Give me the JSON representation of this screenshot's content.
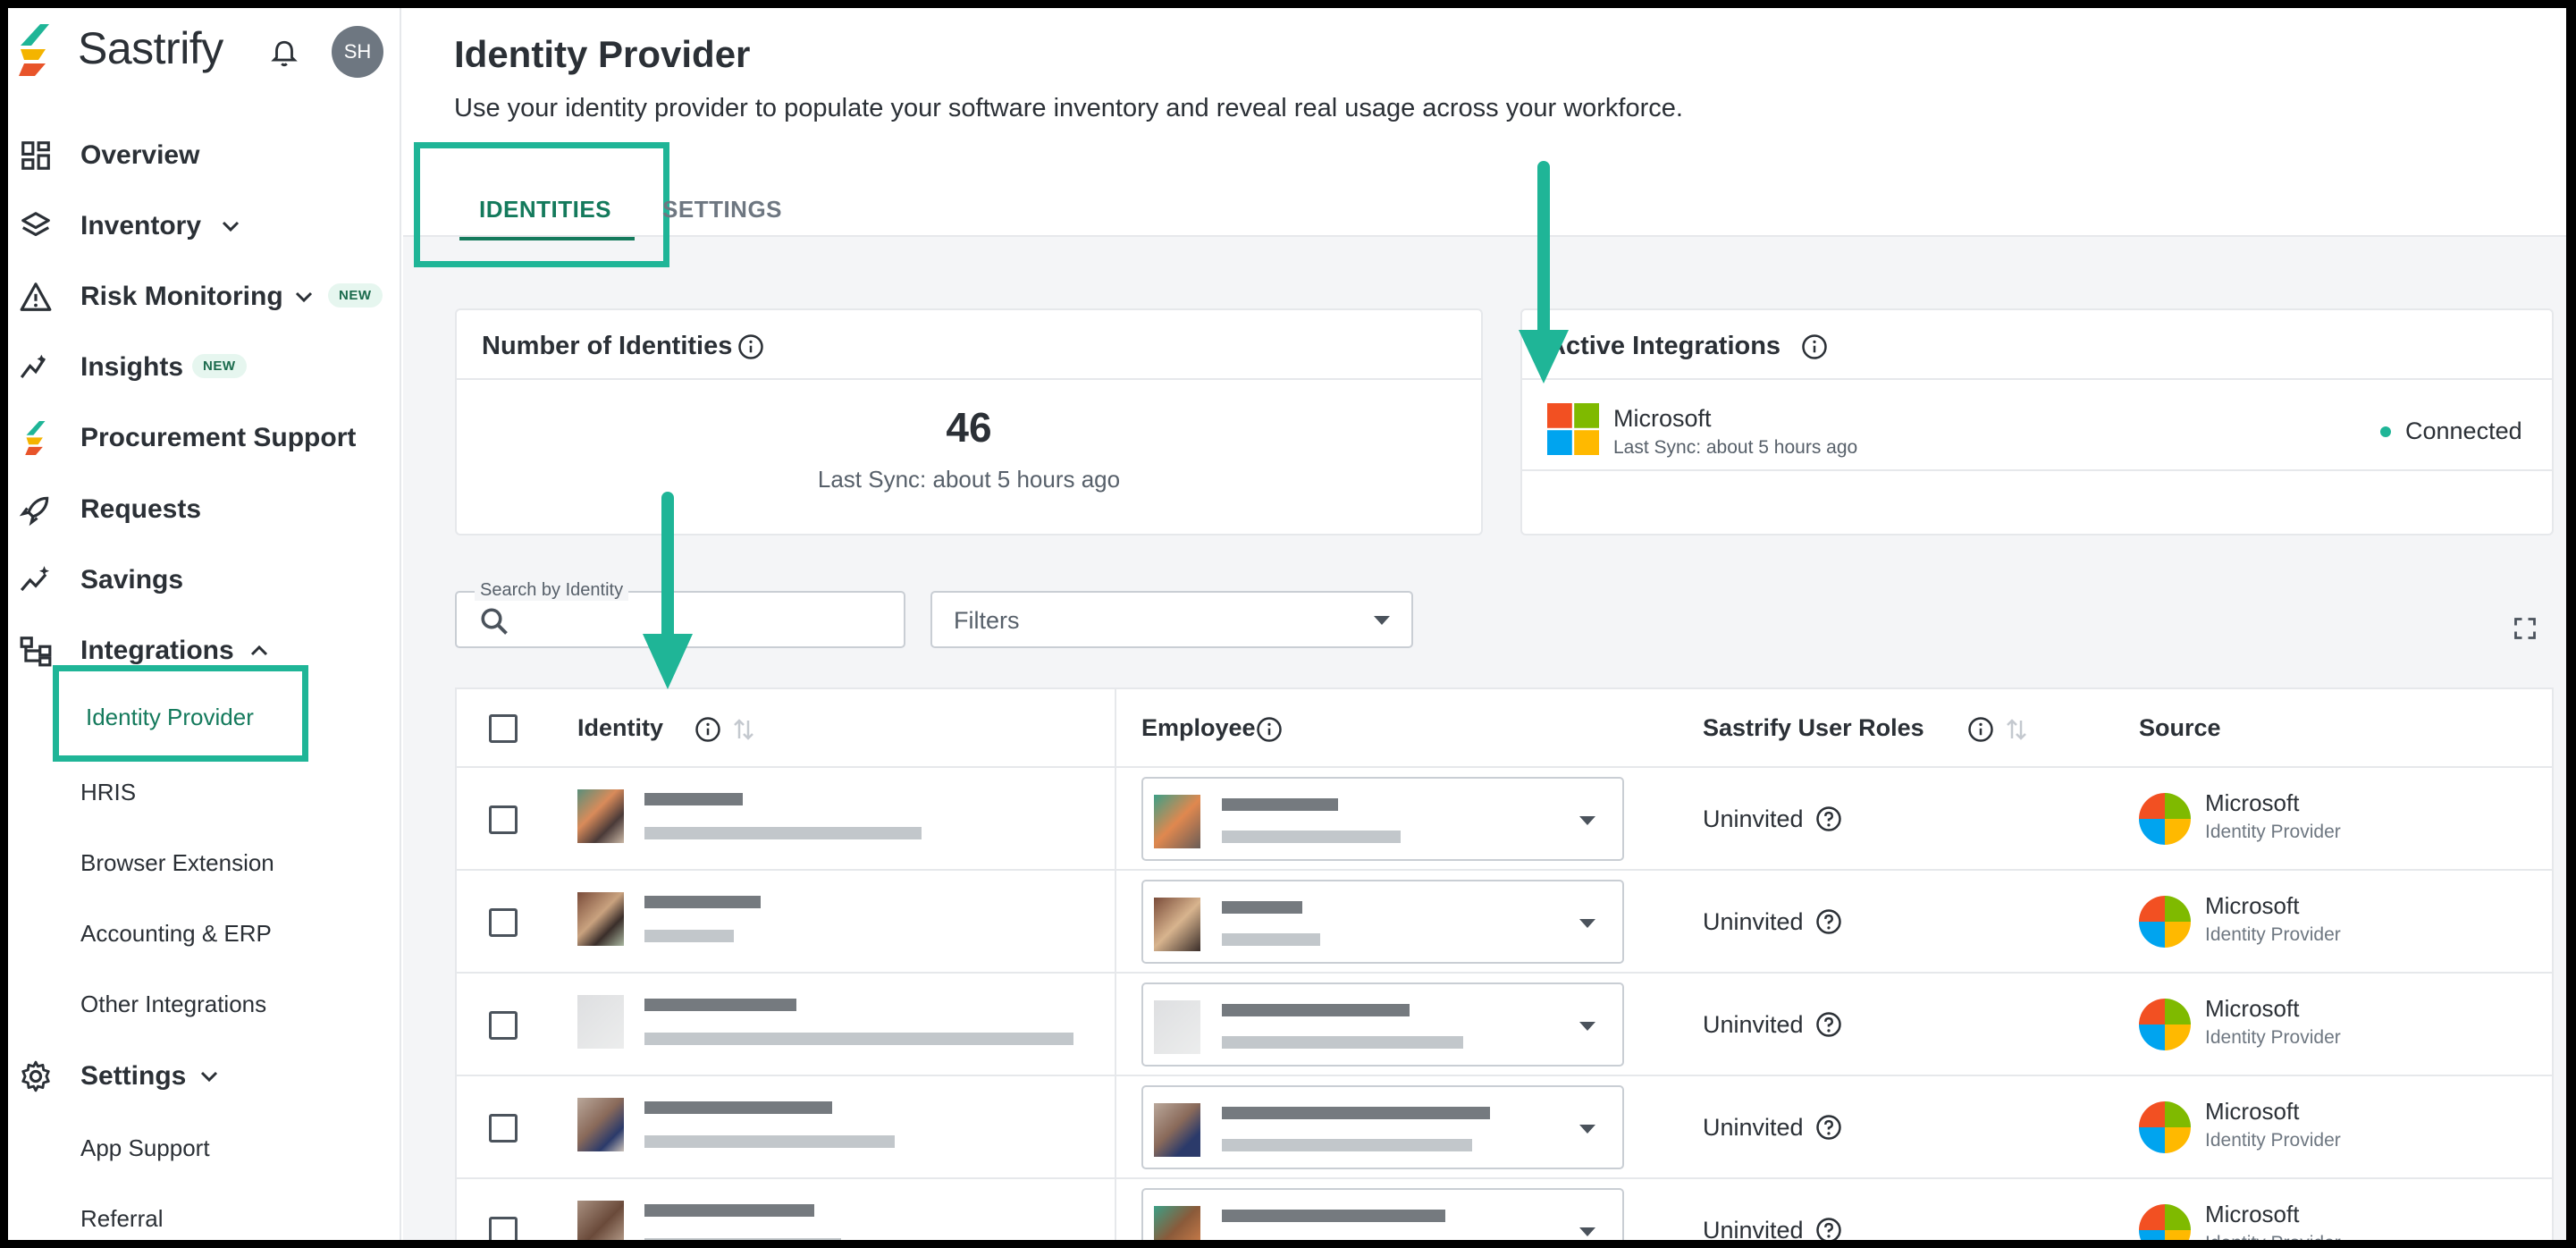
{
  "app": {
    "name": "Sastrify",
    "user_initials": "SH"
  },
  "sidebar": {
    "items": [
      {
        "label": "Overview",
        "icon": "dashboard-icon"
      },
      {
        "label": "Inventory",
        "icon": "layers-icon"
      },
      {
        "label": "Risk Monitoring",
        "icon": "warning-icon",
        "badge": "NEW"
      },
      {
        "label": "Insights",
        "icon": "insights-icon",
        "badge": "NEW"
      },
      {
        "label": "Procurement Support",
        "icon": "sastrify-logo-icon"
      },
      {
        "label": "Requests",
        "icon": "rocket-icon"
      },
      {
        "label": "Savings",
        "icon": "savings-icon"
      },
      {
        "label": "Integrations",
        "icon": "integrations-icon"
      },
      {
        "label": "Settings",
        "icon": "gear-icon"
      }
    ],
    "integrations_sub": [
      "Identity Provider",
      "HRIS",
      "Browser Extension",
      "Accounting & ERP",
      "Other Integrations"
    ],
    "settings_sub": [
      "App Support",
      "Referral"
    ]
  },
  "page": {
    "title": "Identity Provider",
    "subtitle": "Use your identity provider to populate your software inventory and reveal real usage across your workforce.",
    "tabs": [
      "IDENTITIES",
      "SETTINGS"
    ]
  },
  "identities_card": {
    "title": "Number of Identities",
    "count": "46",
    "last_sync": "Last Sync: about 5 hours ago"
  },
  "integrations_card": {
    "title": "Active Integrations",
    "provider": "Microsoft",
    "last_sync": "Last Sync: about 5 hours ago",
    "status": "Connected",
    "status_color": "#1fb597"
  },
  "search": {
    "label": "Search by Identity"
  },
  "filters": {
    "label": "Filters"
  },
  "table": {
    "columns": [
      "Identity",
      "Employee",
      "Sastrify User Roles",
      "Source"
    ],
    "rows": [
      {
        "role": "Uninvited",
        "source": "Microsoft",
        "source_type": "Identity Provider"
      },
      {
        "role": "Uninvited",
        "source": "Microsoft",
        "source_type": "Identity Provider"
      },
      {
        "role": "Uninvited",
        "source": "Microsoft",
        "source_type": "Identity Provider"
      },
      {
        "role": "Uninvited",
        "source": "Microsoft",
        "source_type": "Identity Provider"
      },
      {
        "role": "Uninvited",
        "source": "Microsoft",
        "source_type": "Identity Provider"
      }
    ]
  },
  "colors": {
    "accent": "#1fb597",
    "active_text": "#147a5c"
  }
}
